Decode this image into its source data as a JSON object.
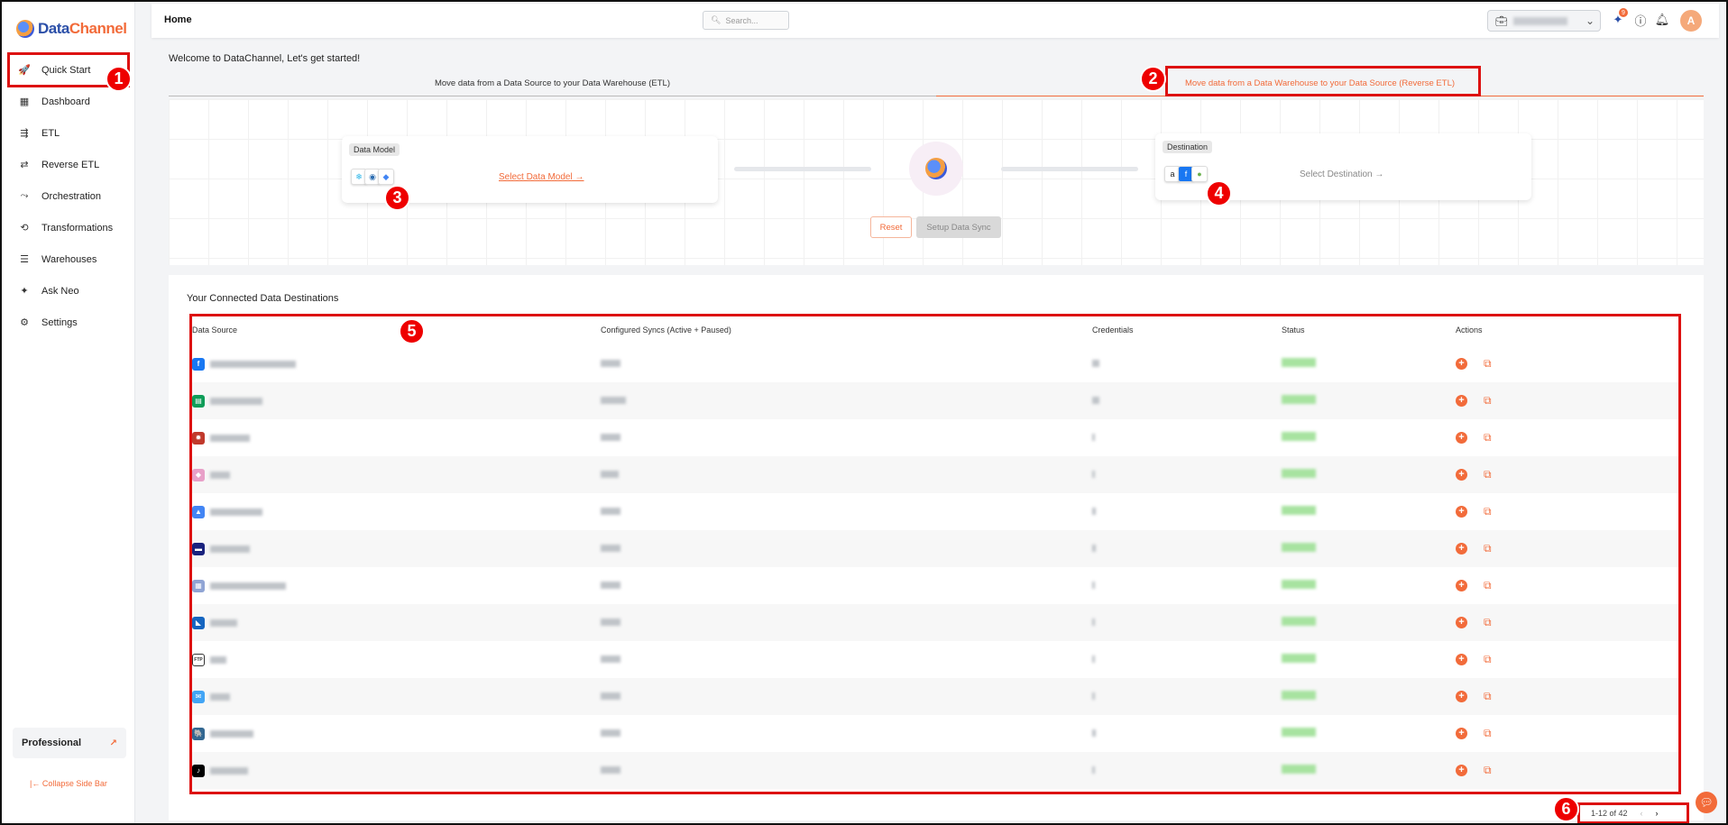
{
  "app": {
    "logo_part1": "Data",
    "logo_part2": "Channel"
  },
  "sidebar": {
    "items": [
      {
        "label": "Quick Start",
        "icon": "rocket-icon"
      },
      {
        "label": "Dashboard",
        "icon": "grid-icon"
      },
      {
        "label": "ETL",
        "icon": "flow-icon"
      },
      {
        "label": "Reverse ETL",
        "icon": "reverse-icon"
      },
      {
        "label": "Orchestration",
        "icon": "orchestration-icon"
      },
      {
        "label": "Transformations",
        "icon": "transform-icon"
      },
      {
        "label": "Warehouses",
        "icon": "list-icon"
      },
      {
        "label": "Ask Neo",
        "icon": "sparkle-icon"
      },
      {
        "label": "Settings",
        "icon": "gear-icon"
      }
    ],
    "plan": "Professional",
    "collapse_label": "Collapse Side Bar"
  },
  "topbar": {
    "title": "Home",
    "search_placeholder": "Search...",
    "notif_count": "9",
    "avatar_initial": "A"
  },
  "main": {
    "welcome": "Welcome to DataChannel, Let's get started!",
    "tabs": [
      {
        "label": "Move data from a Data Source to your Data Warehouse (ETL)"
      },
      {
        "label": "Move data from a Data Warehouse to your Data Source (Reverse ETL)"
      }
    ],
    "flow": {
      "model_chip": "Data Model",
      "model_link": "Select Data Model →",
      "dest_chip": "Destination",
      "dest_link": "Select Destination →",
      "reset": "Reset",
      "setup": "Setup Data Sync"
    }
  },
  "panel": {
    "title": "Your Connected Data Destinations",
    "columns": [
      "Data Source",
      "Configured Syncs (Active + Paused)",
      "Credentials",
      "Status",
      "Actions"
    ],
    "rows": [
      {
        "icon": "facebook-icon",
        "color": "#1877f2",
        "glyph": "f"
      },
      {
        "icon": "google-sheets-icon",
        "color": "#0f9d58",
        "glyph": "▤"
      },
      {
        "icon": "app-icon",
        "color": "#c0392b",
        "glyph": "✹"
      },
      {
        "icon": "app-icon",
        "color": "#e8a0c8",
        "glyph": "◆"
      },
      {
        "icon": "google-ads-icon",
        "color": "#4285f4",
        "glyph": "▲"
      },
      {
        "icon": "app-icon",
        "color": "#1a237e",
        "glyph": "▬"
      },
      {
        "icon": "table-icon",
        "color": "#90a4d4",
        "glyph": "▦"
      },
      {
        "icon": "app-icon",
        "color": "#1565c0",
        "glyph": "◣"
      },
      {
        "icon": "ftp-icon",
        "color": "#333333",
        "glyph": "FTP"
      },
      {
        "icon": "mail-icon",
        "color": "#42a5f5",
        "glyph": "✉"
      },
      {
        "icon": "postgres-icon",
        "color": "#336791",
        "glyph": "🐘"
      },
      {
        "icon": "tiktok-icon",
        "color": "#000000",
        "glyph": "♪"
      }
    ],
    "pager": "1-12 of 42"
  },
  "annotations": [
    "1",
    "2",
    "3",
    "4",
    "5",
    "6"
  ]
}
